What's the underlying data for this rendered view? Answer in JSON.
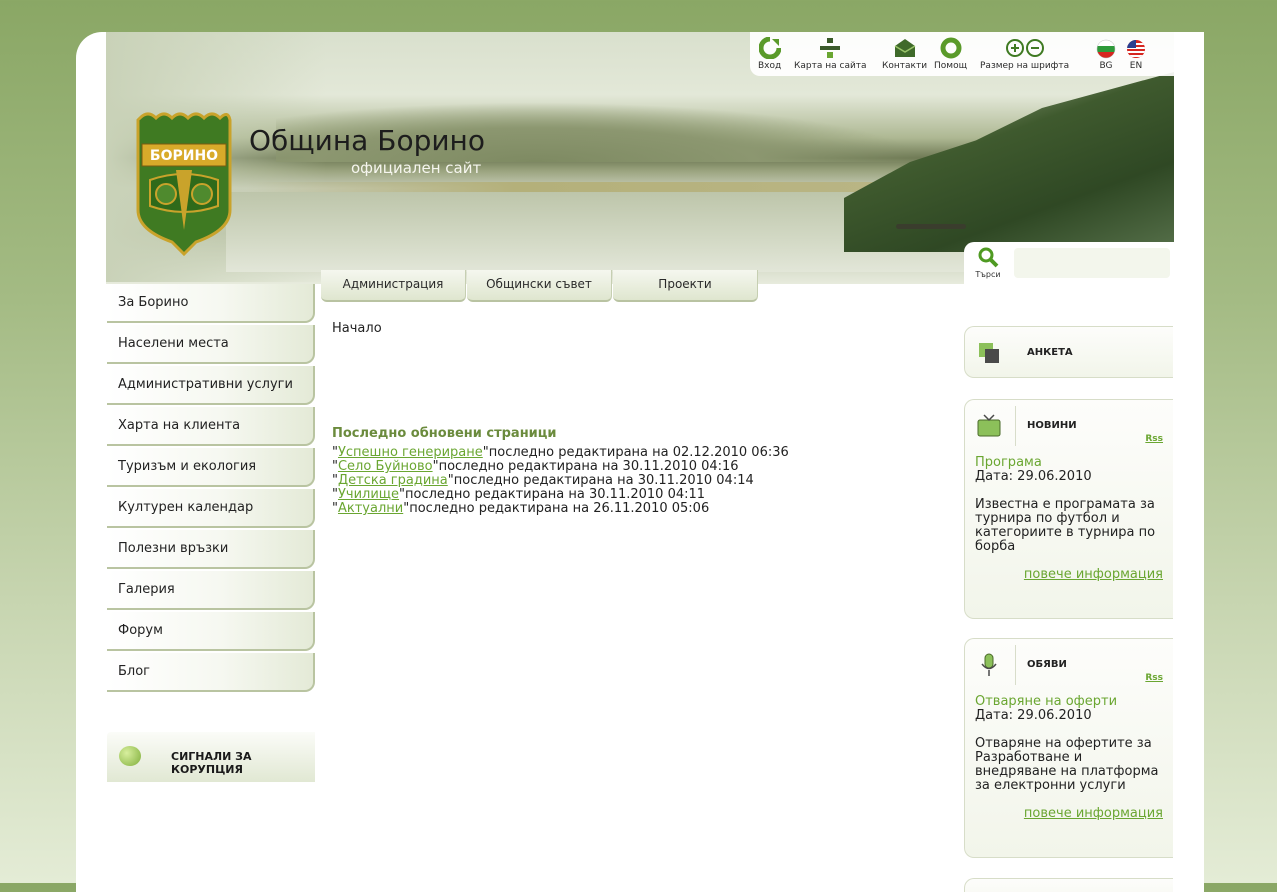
{
  "header": {
    "site_title": "Община Борино",
    "site_subtitle": "официален сайт",
    "emblem_text": "БОРИНО"
  },
  "toolbar": {
    "login": "Вход",
    "sitemap": "Карта на сайта",
    "contacts": "Контакти",
    "help": "Помощ",
    "font_size": "Размер на шрифта",
    "bg": "BG",
    "en": "EN"
  },
  "search": {
    "button": "Търси",
    "placeholder": ""
  },
  "tabs": [
    "Администрация",
    "Общински съвет",
    "Проекти"
  ],
  "sidebar": {
    "items": [
      "За Борино",
      "Населени места",
      "Административни услуги",
      "Харта на клиента",
      "Туризъм и екология",
      "Културен календар",
      "Полезни връзки",
      "Галерия",
      "Форум",
      "Блог"
    ],
    "corruption_label": "СИГНАЛИ ЗА КОРУПЦИЯ"
  },
  "main": {
    "breadcrumb": "Начало",
    "recent_title": "Последно обновени страници",
    "recent": [
      {
        "link": "Успешно генериране",
        "text": "\"последно редактирана на 02.12.2010 06:36"
      },
      {
        "link": "Село Буйново",
        "text": "\"последно редактирана на 30.11.2010 04:16"
      },
      {
        "link": "Детска градина",
        "text": "\"последно редактирана на 30.11.2010 04:14"
      },
      {
        "link": "Училище",
        "text": "\"последно редактирана на 30.11.2010 04:11"
      },
      {
        "link": "Актуални",
        "text": "\"последно редактирана на 26.11.2010 05:06"
      }
    ]
  },
  "right": {
    "poll": {
      "title": "АНКЕТА"
    },
    "news": {
      "title": "НОВИНИ",
      "rss": "Rss",
      "item_title": "Програма",
      "date": "Дата: 29.06.2010",
      "body": "Известна е програмата за турнира по футбол и категориите в турнира по борба",
      "more": "повече информация"
    },
    "ads": {
      "title": "ОБЯВИ",
      "rss": "Rss",
      "item_title": "Отваряне на оферти",
      "date": "Дата: 29.06.2010",
      "body": "Отваряне на офертите за Разработване и внедряване на платформа за електронни услуги",
      "more": "повече информация"
    }
  },
  "colors": {
    "accent_green": "#6aa631",
    "title_green": "#6b8b3d",
    "bg_green": "#8aa765"
  }
}
